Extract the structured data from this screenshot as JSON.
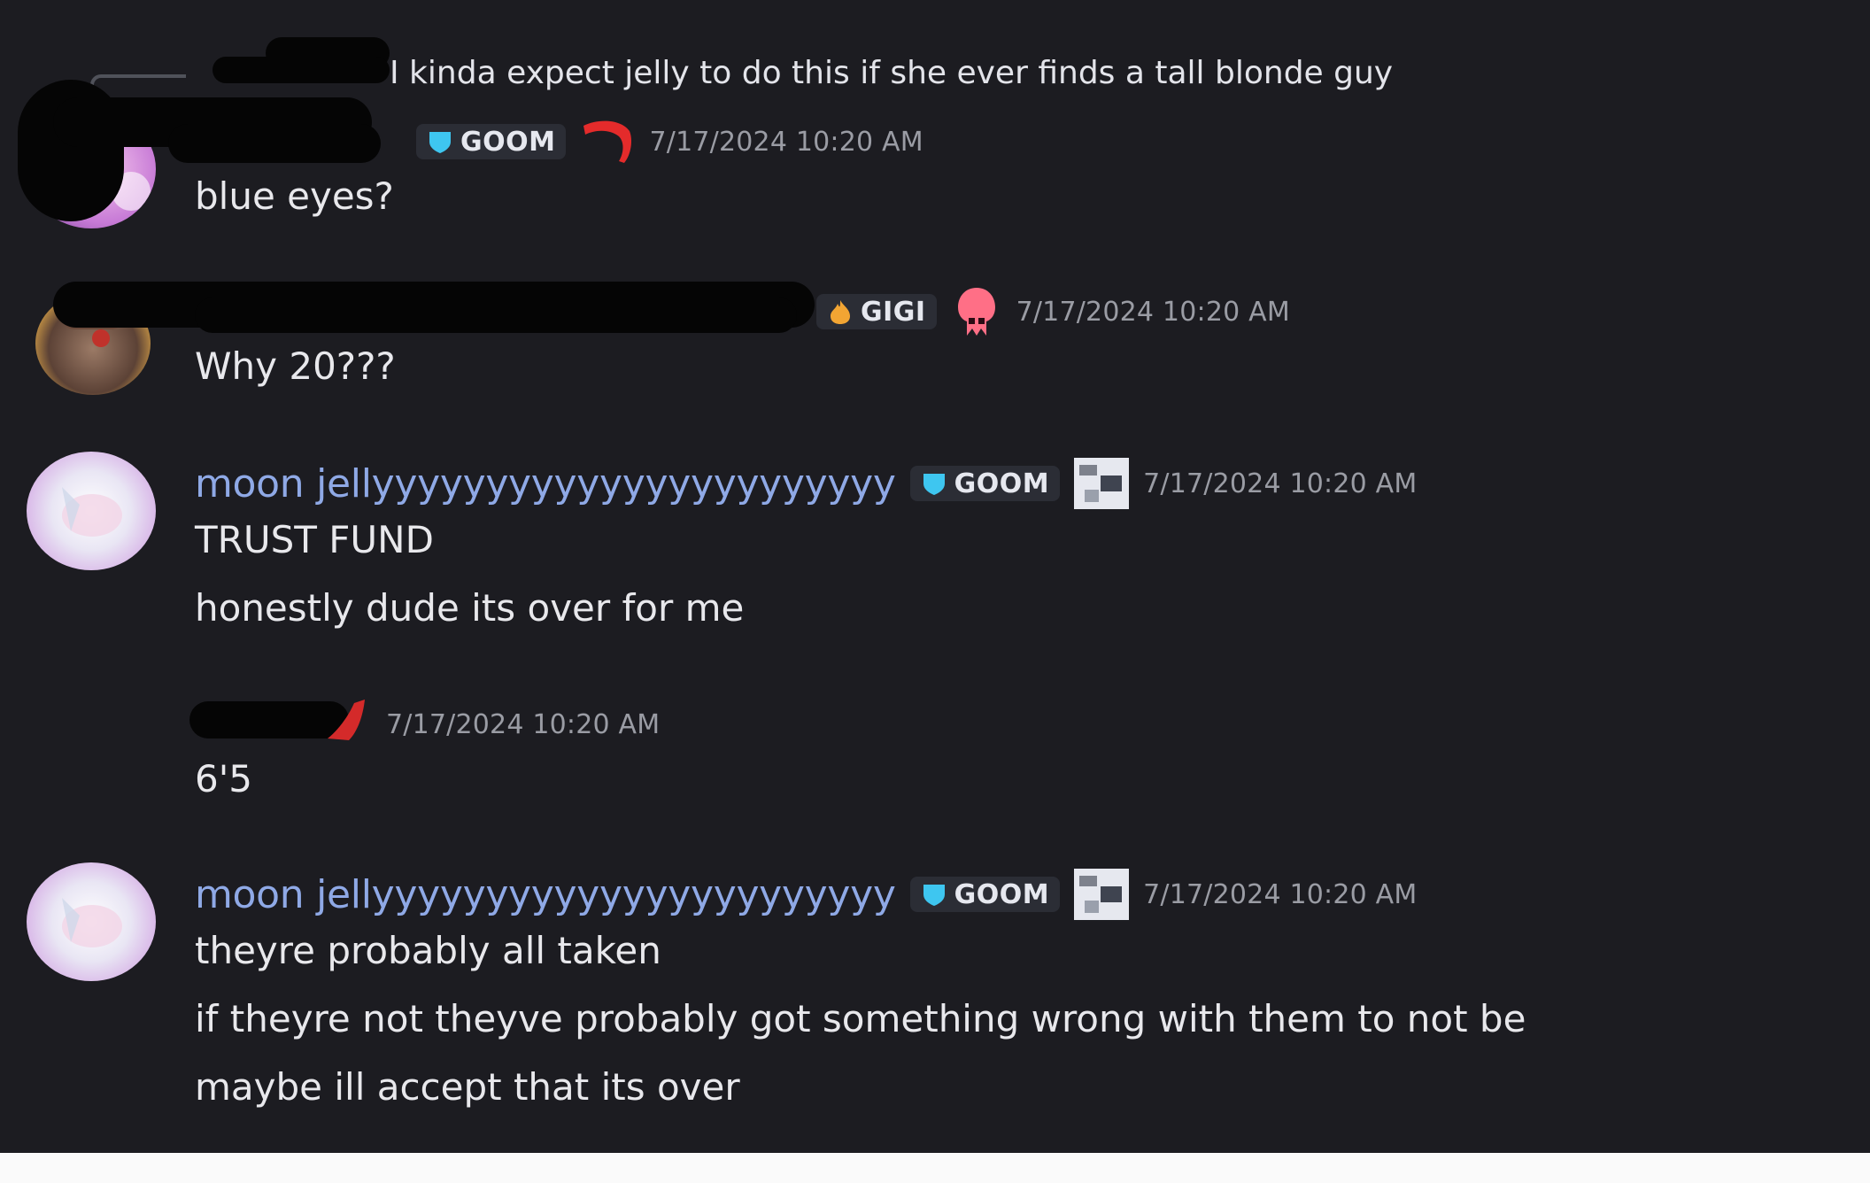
{
  "reply": {
    "text": "I kinda expect jelly to do this if she ever finds a tall blonde guy"
  },
  "messages": [
    {
      "role_tag": "GOOM",
      "timestamp": "7/17/2024 10:20 AM",
      "lines": [
        "blue eyes?"
      ]
    },
    {
      "role_tag": "GIGI",
      "timestamp": "7/17/2024 10:20 AM",
      "lines": [
        "Why 20???"
      ]
    },
    {
      "username": "moon jellyyyyyyyyyyyyyyyyyyyyyyy",
      "role_tag": "GOOM",
      "timestamp": "7/17/2024 10:20 AM",
      "lines": [
        "TRUST FUND",
        "honestly dude its over for me"
      ]
    },
    {
      "timestamp": "7/17/2024 10:20 AM",
      "lines": [
        "6'5"
      ]
    },
    {
      "username": "moon jellyyyyyyyyyyyyyyyyyyyyyyy",
      "role_tag": "GOOM",
      "timestamp": "7/17/2024 10:20 AM",
      "lines": [
        "theyre probably all taken",
        "if theyre not theyve probably got something wrong with them to not be",
        "maybe ill accept that its over"
      ]
    }
  ],
  "colors": {
    "background": "#1c1c21",
    "username_blue": "#8fa9e6",
    "timestamp_gray": "#9a9ca4",
    "message_text": "#e8e8ec",
    "goom_icon": "#3ec6f0",
    "gigi_icon": "#f2a533",
    "redaction": "#050505"
  },
  "icons": {
    "goom_role": "shield-heart-icon",
    "gigi_role": "flame-icon",
    "badge_red": "red-ribbon-icon",
    "badge_squid": "pink-squid-icon",
    "badge_pixel": "pixel-art-icon"
  }
}
